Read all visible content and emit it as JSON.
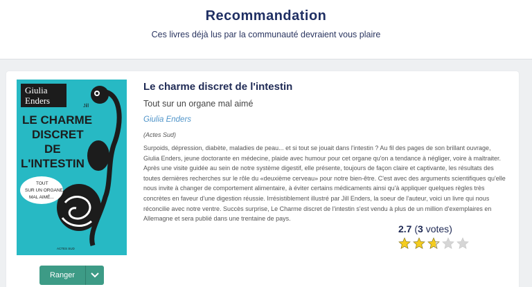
{
  "header": {
    "title": "Recommandation",
    "subtitle": "Ces livres déjà lus par la communauté devraient vous plaire"
  },
  "book": {
    "title": "Le charme discret de l'intestin",
    "subtitle": "Tout sur un organe mal aimé",
    "author": "Giulia Enders",
    "publisher": "(Actes Sud)",
    "description": "Surpoids, dépression, diabète, maladies de peau... et si tout se jouait dans l'intestin ? Au fil des pages de son brillant ouvrage, Giulia Enders, jeune doctorante en médecine, plaide avec humour pour cet organe qu'on a tendance à négliger, voire à maltraiter. Après une visite guidée au sein de notre système digestif, elle présente, toujours de façon claire et captivante, les résultats des toutes dernières recherches sur le rôle du «deuxième cerveau» pour notre bien-être. C'est avec des arguments scientifiques qu'elle nous invite à changer de comportement alimentaire, à éviter certains médicaments ainsi qu'à appliquer quelques règles très concrètes en faveur d'une digestion réussie. Irrésistiblement illustré par Jill Enders, la soeur de l'auteur, voici un livre qui nous réconcilie avec notre ventre. Succès surprise, Le Charme discret de l'intestin s'est vendu à plus de un million d'exemplaires en Allemagne et sera publié dans une trentaine de pays.",
    "cover": {
      "author_line1": "Giulia",
      "author_line2": "Enders",
      "title_line1": "LE CHARME",
      "title_line2": "DISCRET",
      "title_line3": "DE",
      "title_line4": "L'INTESTIN",
      "tag_line1": "TOUT",
      "tag_line2": "SUR UN ORGANE",
      "tag_line3": "MAL AIMÉ...",
      "illustration_label": "Jill",
      "publisher_mark": "ACTES SUD",
      "background_color": "#27b9c4"
    }
  },
  "rating": {
    "score": "2.7",
    "votes_count": "3",
    "votes_label": "votes",
    "stars_value": 2.7,
    "stars_max": 5,
    "star_color": "#f5cd1f",
    "star_empty_color": "#d6d6d6"
  },
  "actions": {
    "ranger_label": "Ranger",
    "button_color": "#3d9b86"
  }
}
